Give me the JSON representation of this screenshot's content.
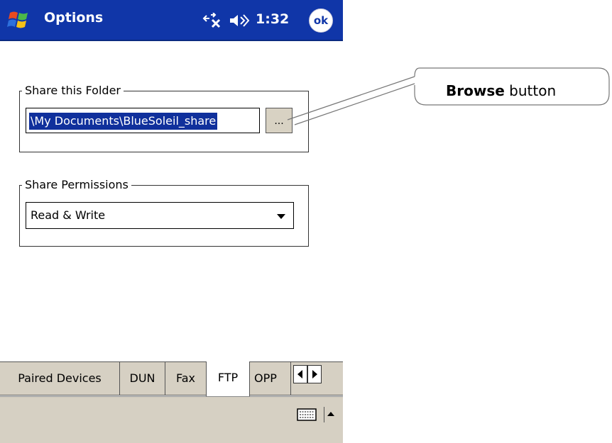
{
  "titlebar": {
    "title": "Options",
    "time": "1:32",
    "ok_label": "ok",
    "icons": [
      "windows-start-icon",
      "connectivity-icon",
      "volume-icon"
    ],
    "colors": {
      "background": "#1036a8",
      "text": "#ffffff"
    }
  },
  "share_folder": {
    "legend": "Share this Folder",
    "path": "\\My Documents\\BlueSoleil_share",
    "browse_label": "...",
    "selection_color": "#10309c"
  },
  "share_permissions": {
    "legend": "Share Permissions",
    "selected": "Read & Write"
  },
  "tabs": [
    {
      "label": "Paired Devices",
      "active": false
    },
    {
      "label": "DUN",
      "active": false
    },
    {
      "label": "Fax",
      "active": false
    },
    {
      "label": "FTP",
      "active": true
    },
    {
      "label": "OPP",
      "active": false
    }
  ],
  "tab_scroll_icons": [
    "scroll-left-icon",
    "scroll-right-icon"
  ],
  "bottom_bar": {
    "icons": [
      "keyboard-icon",
      "input-panel-arrow-icon"
    ]
  },
  "callout": {
    "bold": "Browse",
    "rest": " button"
  }
}
